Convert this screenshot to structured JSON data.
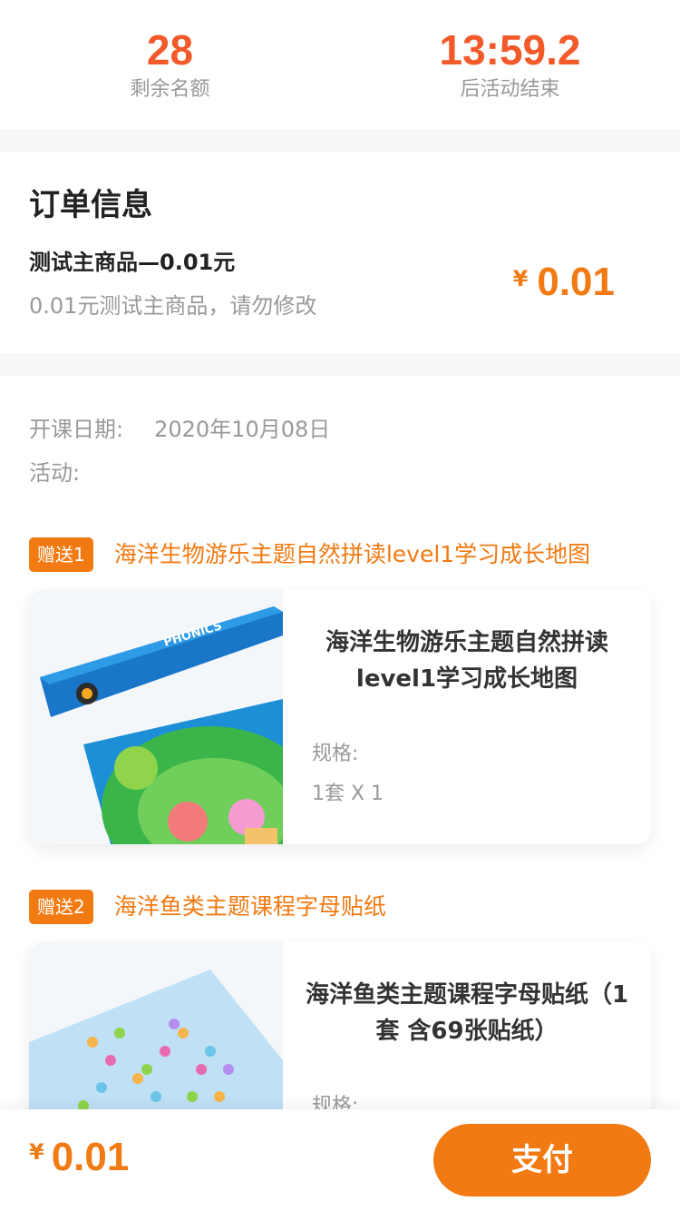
{
  "stats": {
    "remaining_value": "28",
    "remaining_label": "剩余名额",
    "countdown_value": "13:59.2",
    "countdown_label": "后活动结束"
  },
  "order": {
    "title": "订单信息",
    "product_name": "测试主商品—0.01元",
    "product_desc": "0.01元测试主商品，请勿修改",
    "currency": "¥",
    "price": "0.01"
  },
  "details": {
    "start_date_label": "开课日期:",
    "start_date_value": "2020年10月08日",
    "activity_label": "活动:"
  },
  "gifts": [
    {
      "badge": "赠送1",
      "title": "海洋生物游乐主题自然拼读level1学习成长地图",
      "name": "海洋生物游乐主题自然拼读level1学习成长地图",
      "spec_label": "规格:",
      "spec_value": "1套 X 1",
      "image_text": "PHONICS"
    },
    {
      "badge": "赠送2",
      "title": "海洋鱼类主题课程字母贴纸",
      "name": "海洋鱼类主题课程字母贴纸（1套 含69张贴纸）",
      "spec_label": "规格:",
      "spec_value": ""
    }
  ],
  "footer": {
    "currency": "¥",
    "price": "0.01",
    "pay_label": "支付"
  },
  "colors": {
    "accent_orange": "#f27a12",
    "countdown_red": "#f25a2a"
  }
}
